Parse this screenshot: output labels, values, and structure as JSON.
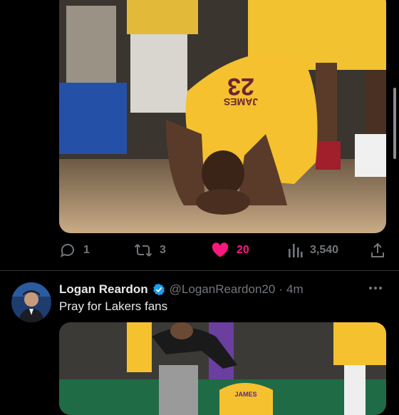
{
  "tweet_top": {
    "actions": {
      "reply_count": "1",
      "retweet_count": "3",
      "like_count": "20",
      "view_count": "3,540"
    }
  },
  "tweet_bottom": {
    "display_name": "Logan Reardon",
    "handle": "@LoganReardon20",
    "separator": "·",
    "time": "4m",
    "text": "Pray for Lakers fans"
  },
  "jersey": {
    "top_number": "23",
    "top_name": "JAMES",
    "bottom_name": "JAMES"
  },
  "colors": {
    "background": "#000000",
    "text": "#e7e9ea",
    "muted": "#71767b",
    "like": "#f91880",
    "verified": "#1d9bf0",
    "lakers_gold": "#f5c12e"
  },
  "icons": {
    "reply": "reply-icon",
    "retweet": "retweet-icon",
    "like": "heart-icon",
    "views": "views-icon",
    "share": "share-icon",
    "verified": "verified-badge-icon",
    "more": "more-icon"
  }
}
